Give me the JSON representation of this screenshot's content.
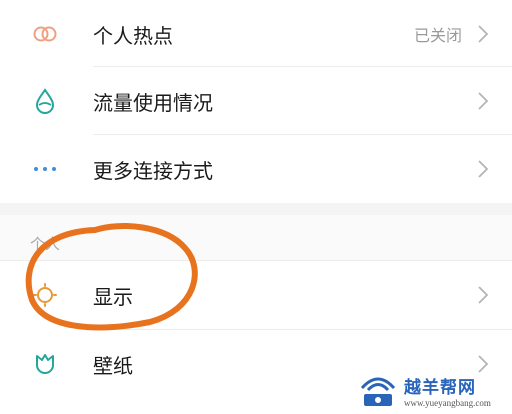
{
  "settings": {
    "items": [
      {
        "label": "个人热点",
        "value": "已关闭",
        "icon": "hotspot-icon"
      },
      {
        "label": "流量使用情况",
        "value": "",
        "icon": "data-usage-icon"
      },
      {
        "label": "更多连接方式",
        "value": "",
        "icon": "more-connections-icon"
      }
    ],
    "section_title": "个人",
    "personal_items": [
      {
        "label": "显示",
        "icon": "display-icon"
      },
      {
        "label": "壁纸",
        "icon": "wallpaper-icon"
      }
    ]
  },
  "colors": {
    "accent": "#26a69a",
    "annotation": "#e8731f"
  },
  "watermark": {
    "name": "越羊帮网",
    "url": "www.yueyangbang.com"
  }
}
